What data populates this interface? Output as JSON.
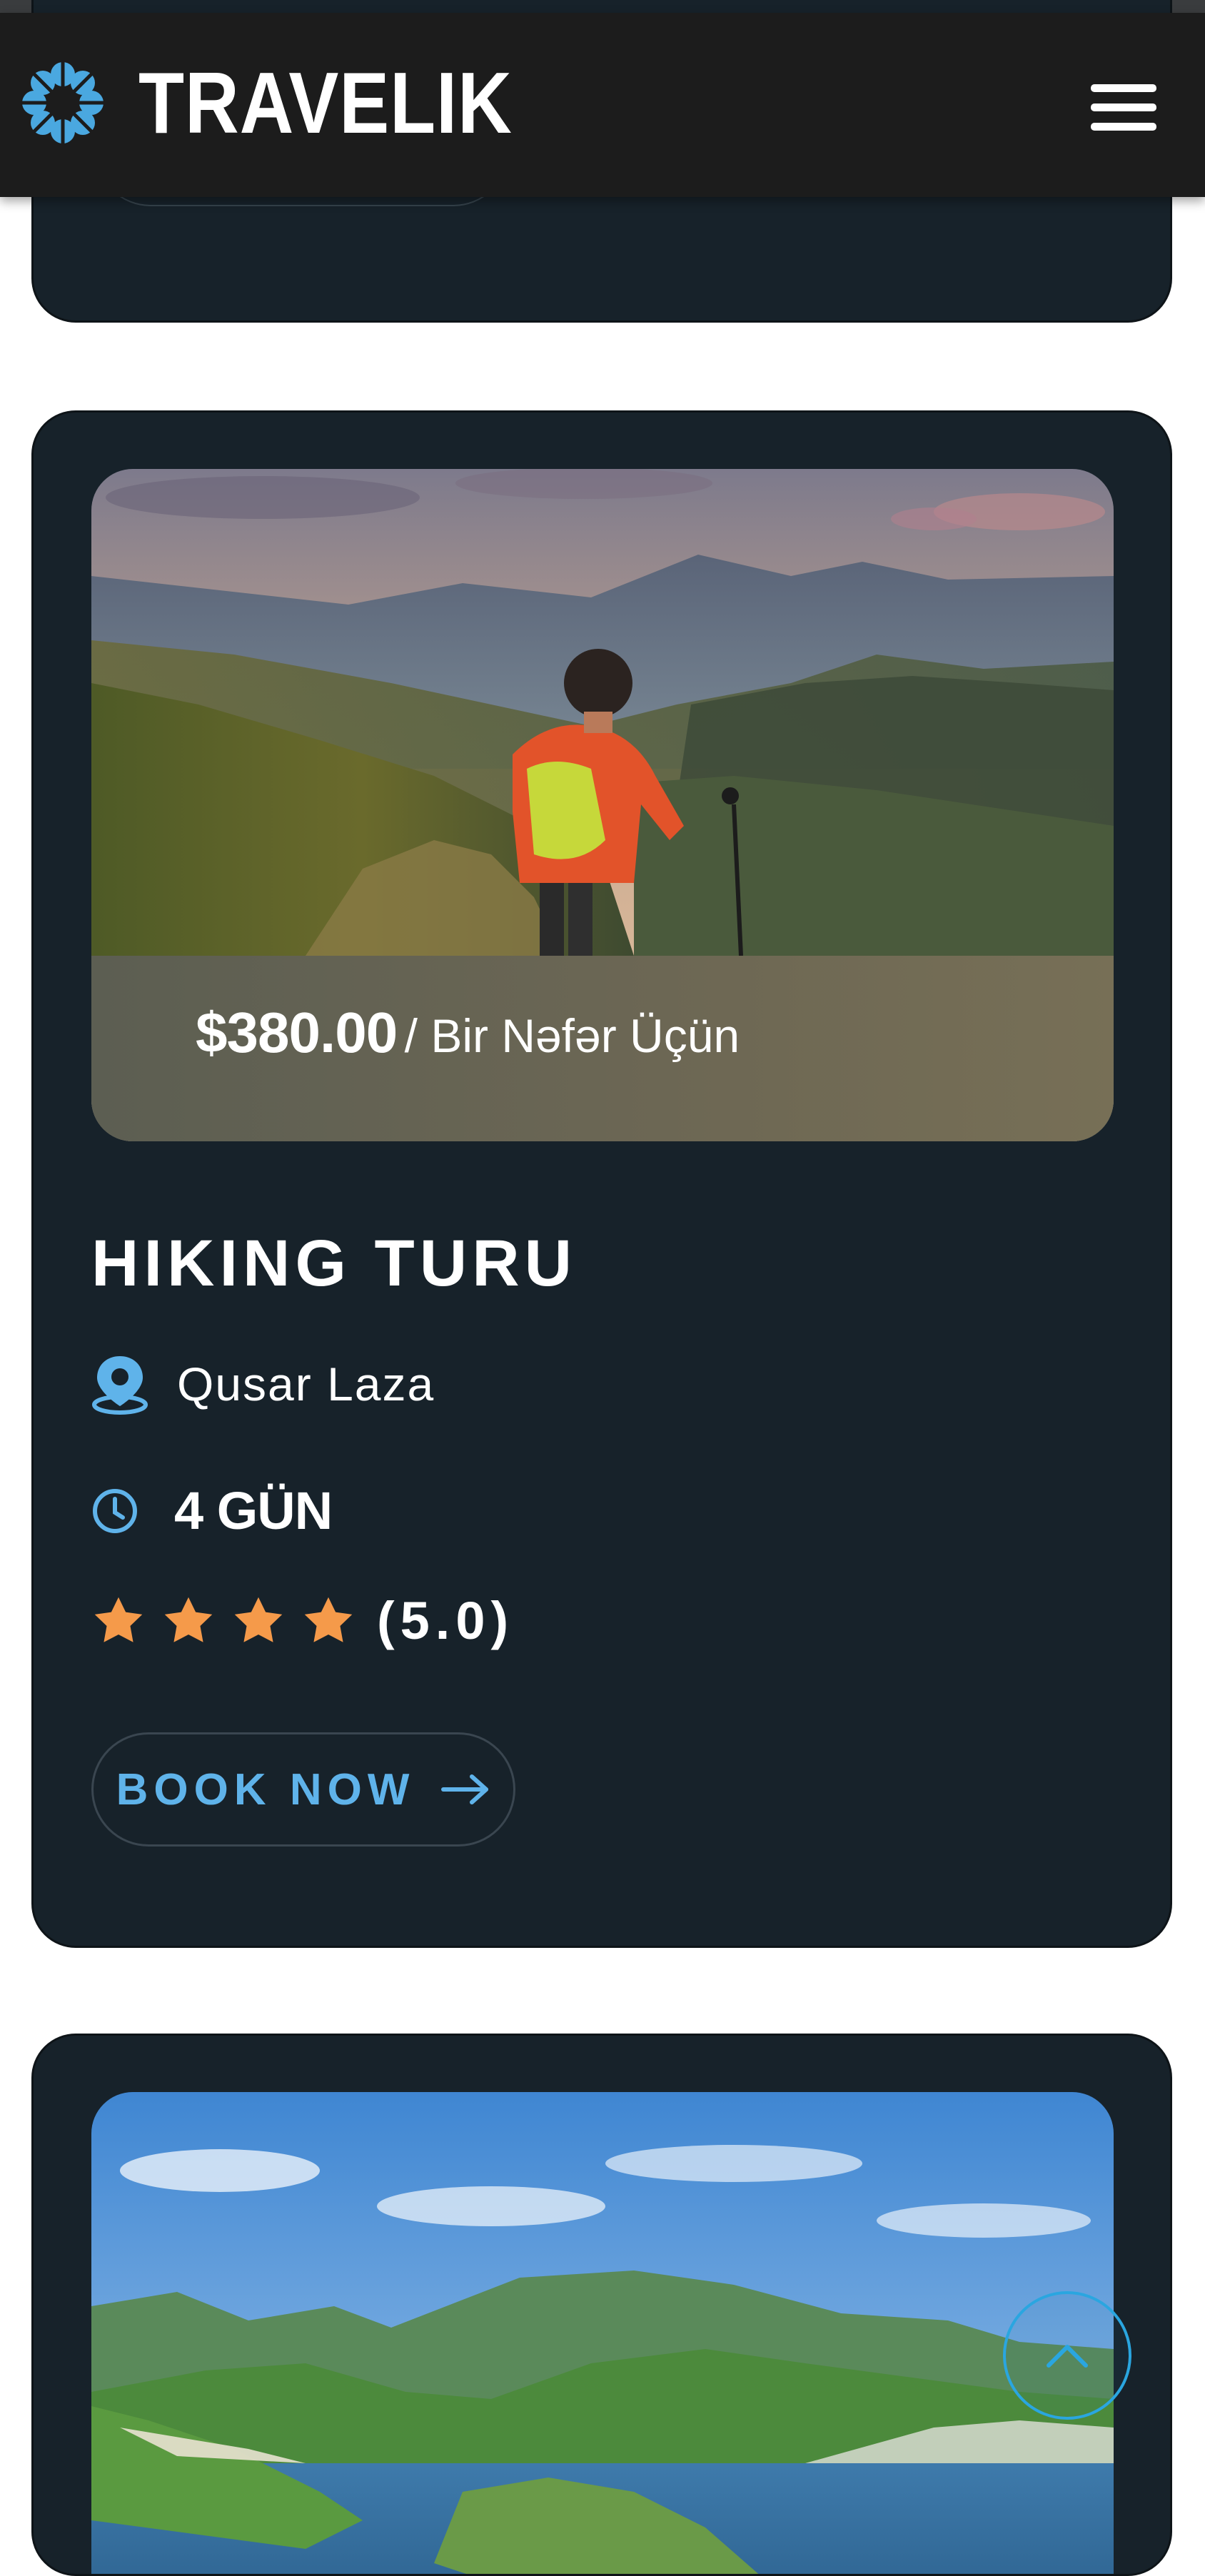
{
  "header": {
    "brand": "TRAVELIK",
    "logo_icon": "flower-logo-icon",
    "menu_icon": "hamburger-menu-icon"
  },
  "tour": {
    "price": "$380.00",
    "price_suffix": "/ Bir Nəfər Üçün",
    "title": "HIKING TURU",
    "location": "Qusar Laza",
    "duration": "4 GÜN",
    "rating_stars": 4,
    "rating_text": "(5.0)",
    "book_label": "BOOK NOW"
  },
  "colors": {
    "accent": "#5fb3ea",
    "star": "#f59a4a",
    "card_bg": "#17222a",
    "header_bg": "#1c1c1c"
  },
  "icons": {
    "location": "map-pin-icon",
    "duration": "clock-icon",
    "rating": "star-icon",
    "book": "arrow-right-icon",
    "scroll_top": "chevron-up-icon"
  }
}
